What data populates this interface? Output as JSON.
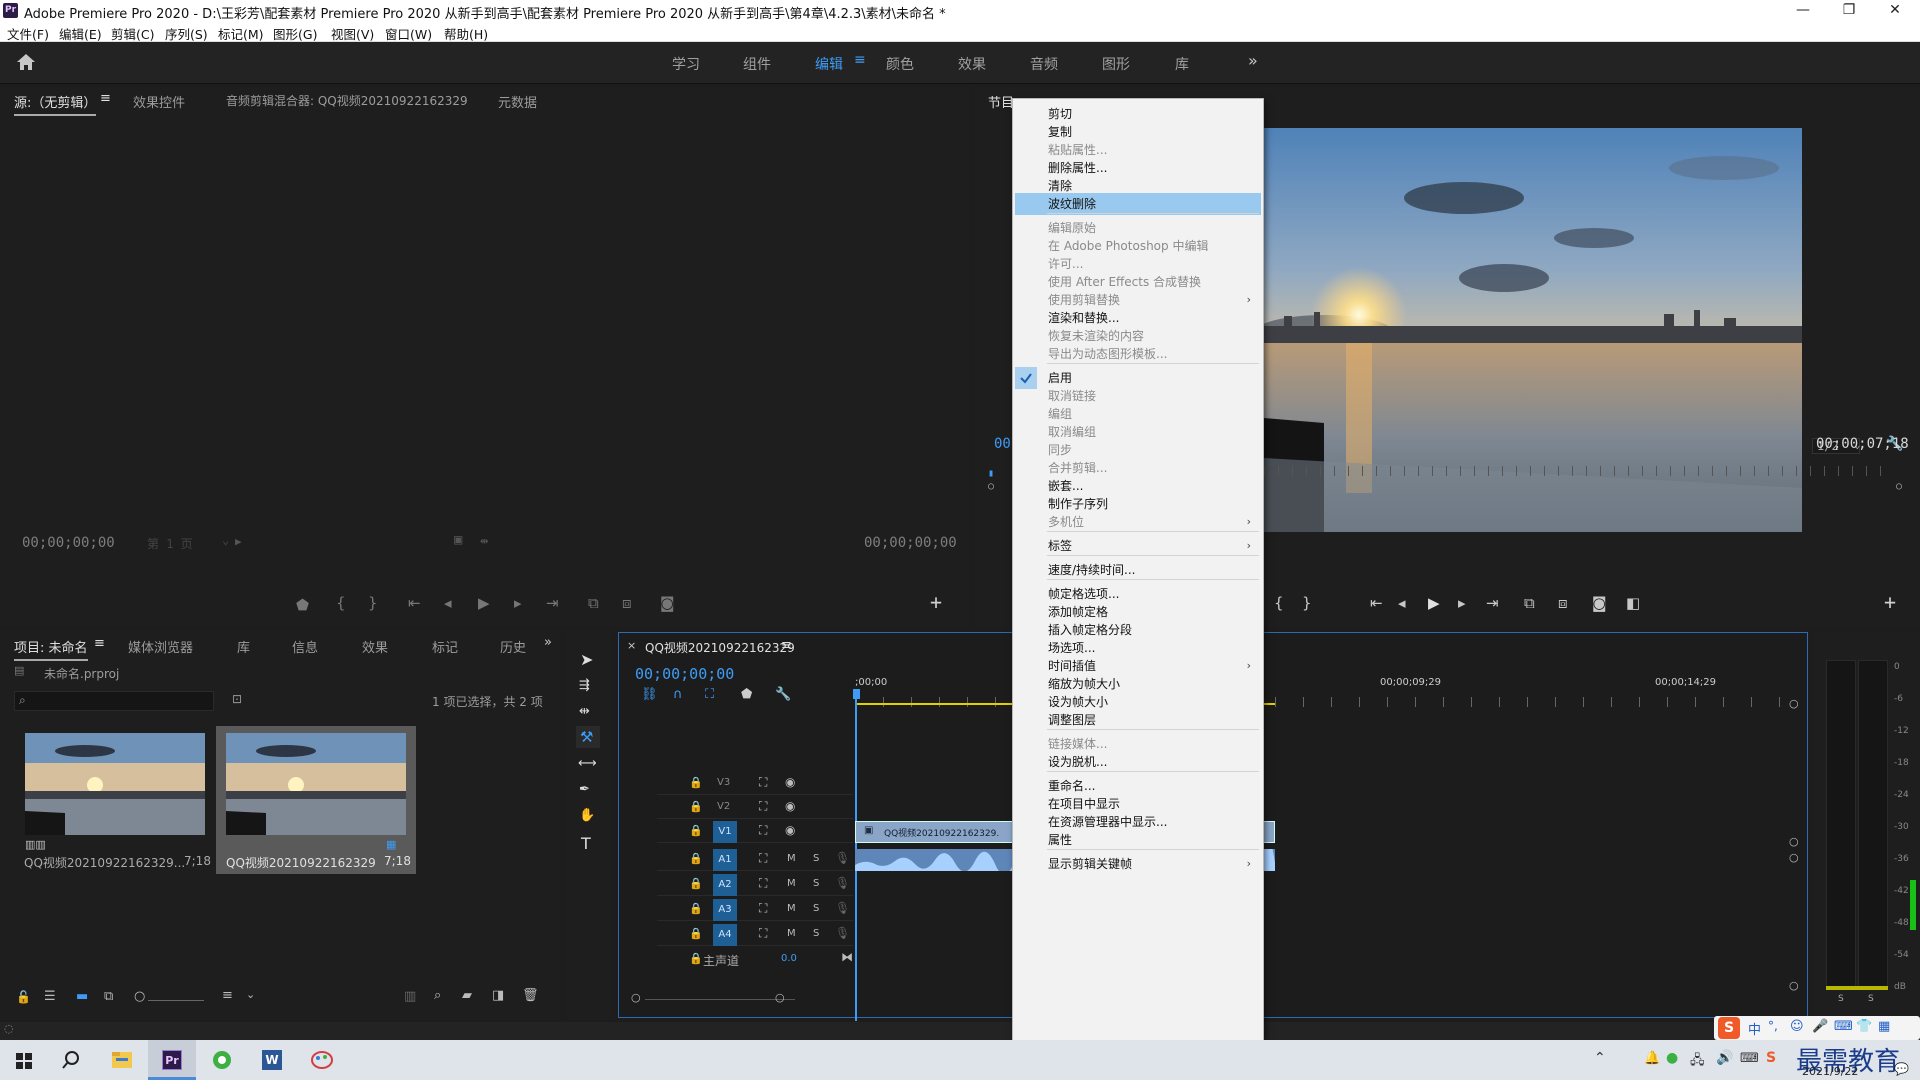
{
  "titlebar": {
    "title": "Adobe Premiere Pro 2020 - D:\\王彩芳\\配套素材 Premiere Pro 2020 从新手到高手\\配套素材 Premiere Pro 2020 从新手到高手\\第4章\\4.2.3\\素材\\未命名 *",
    "minimize": "—",
    "maximize": "❐",
    "close": "✕"
  },
  "menubar": [
    "文件(F)",
    "编辑(E)",
    "剪辑(C)",
    "序列(S)",
    "标记(M)",
    "图形(G)",
    "视图(V)",
    "窗口(W)",
    "帮助(H)"
  ],
  "workspaces": {
    "items": [
      "学习",
      "组件",
      "编辑",
      "颜色",
      "效果",
      "音频",
      "图形",
      "库"
    ],
    "active": "编辑",
    "more": "»"
  },
  "source_panel": {
    "tabs": [
      "源:（无剪辑）",
      "效果控件",
      "音频剪辑混合器: QQ视频20210922162329",
      "元数据"
    ],
    "tc_left": "00;00;00;00",
    "tc_right": "00;00;00;00",
    "page": "第 1 页",
    "add": "+"
  },
  "program_panel": {
    "title_prefix": "节目",
    "tc_left": "00",
    "resolution": "1/2",
    "tc_right": "00;00;07;18",
    "add": "+"
  },
  "project_panel": {
    "tabs": [
      "项目: 未命名",
      "媒体浏览器",
      "库",
      "信息",
      "效果",
      "标记",
      "历史"
    ],
    "more": "»",
    "project_file": "未命名.prproj",
    "selection_info": "1 项已选择，共 2 项",
    "items": [
      {
        "name": "QQ视频20210922162329...",
        "duration": "7;18"
      },
      {
        "name": "QQ视频20210922162329",
        "duration": "7;18"
      }
    ]
  },
  "timeline": {
    "sequence_name": "QQ视频20210922162329",
    "timecode": "00;00;00;00",
    "ruler": [
      ";00;00",
      "00;00;09;29",
      "00;00;14;29"
    ],
    "video_tracks": [
      "V3",
      "V2",
      "V1"
    ],
    "audio_tracks": [
      "A1",
      "A2",
      "A3",
      "A4"
    ],
    "master": {
      "label": "主声道",
      "value": "0.0"
    },
    "clip_name": "QQ视频20210922162329.",
    "mute": "M",
    "solo": "S"
  },
  "audio_meter": {
    "ticks": [
      "0",
      "-6",
      "-12",
      "-18",
      "-24",
      "-30",
      "-36",
      "-42",
      "-48",
      "-54",
      "dB"
    ],
    "solo_labels": [
      "S",
      "S"
    ]
  },
  "context_menu": [
    {
      "label": "剪切",
      "enabled": true
    },
    {
      "label": "复制",
      "enabled": true
    },
    {
      "label": "粘贴属性...",
      "enabled": false
    },
    {
      "label": "删除属性...",
      "enabled": true
    },
    {
      "label": "清除",
      "enabled": true
    },
    {
      "label": "波纹删除",
      "enabled": true,
      "highlighted": true
    },
    {
      "sep": true
    },
    {
      "label": "编辑原始",
      "enabled": false
    },
    {
      "label": "在 Adobe Photoshop 中编辑",
      "enabled": false
    },
    {
      "label": "许可...",
      "enabled": false
    },
    {
      "label": "使用 After Effects 合成替换",
      "enabled": false
    },
    {
      "label": "使用剪辑替换",
      "enabled": false,
      "submenu": true
    },
    {
      "label": "渲染和替换...",
      "enabled": true
    },
    {
      "label": "恢复未渲染的内容",
      "enabled": false
    },
    {
      "label": "导出为动态图形模板...",
      "enabled": false
    },
    {
      "sep": true
    },
    {
      "label": "启用",
      "enabled": true,
      "checked": true
    },
    {
      "label": "取消链接",
      "enabled": false
    },
    {
      "label": "编组",
      "enabled": false
    },
    {
      "label": "取消编组",
      "enabled": false
    },
    {
      "label": "同步",
      "enabled": false
    },
    {
      "label": "合并剪辑...",
      "enabled": false
    },
    {
      "label": "嵌套...",
      "enabled": true
    },
    {
      "label": "制作子序列",
      "enabled": true
    },
    {
      "label": "多机位",
      "enabled": false,
      "submenu": true
    },
    {
      "sep": true
    },
    {
      "label": "标签",
      "enabled": true,
      "submenu": true
    },
    {
      "sep": true
    },
    {
      "label": "速度/持续时间...",
      "enabled": true
    },
    {
      "sep": true
    },
    {
      "label": "帧定格选项...",
      "enabled": true
    },
    {
      "label": "添加帧定格",
      "enabled": true
    },
    {
      "label": "插入帧定格分段",
      "enabled": true
    },
    {
      "label": "场选项...",
      "enabled": true
    },
    {
      "label": "时间插值",
      "enabled": true,
      "submenu": true
    },
    {
      "label": "缩放为帧大小",
      "enabled": true
    },
    {
      "label": "设为帧大小",
      "enabled": true
    },
    {
      "label": "调整图层",
      "enabled": true
    },
    {
      "sep": true
    },
    {
      "label": "链接媒体...",
      "enabled": false
    },
    {
      "label": "设为脱机...",
      "enabled": true
    },
    {
      "sep": true
    },
    {
      "label": "重命名...",
      "enabled": true
    },
    {
      "label": "在项目中显示",
      "enabled": true
    },
    {
      "label": "在资源管理器中显示...",
      "enabled": true
    },
    {
      "label": "属性",
      "enabled": true
    },
    {
      "sep": true
    },
    {
      "label": "显示剪辑关键帧",
      "enabled": true,
      "submenu": true
    }
  ],
  "taskbar": {
    "ime": "中",
    "watermark": "最需教育",
    "date": "2021/9/22",
    "pr_label": "Pr",
    "word_label": "W"
  }
}
